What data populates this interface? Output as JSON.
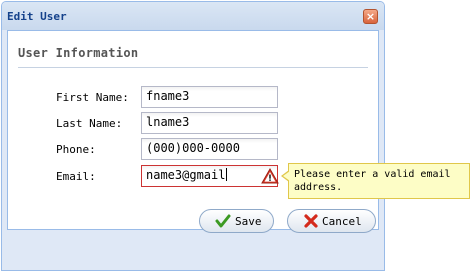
{
  "window": {
    "title": "Edit User",
    "close_label": "×"
  },
  "form": {
    "legend": "User Information",
    "fields": [
      {
        "label": "First Name:",
        "value": "fname3"
      },
      {
        "label": "Last Name:",
        "value": "lname3"
      },
      {
        "label": "Phone:",
        "value": "(000)000-0000"
      },
      {
        "label": "Email:",
        "value": "name3@gmail"
      }
    ]
  },
  "validation": {
    "message": "Please enter a valid email address."
  },
  "buttons": {
    "save": "Save",
    "cancel": "Cancel"
  },
  "icons": {
    "close": "close-icon",
    "warning": "warning-triangle-icon",
    "save": "checkmark-icon",
    "cancel": "red-x-icon"
  },
  "colors": {
    "title_text": "#15428b",
    "error_border": "#cc3333",
    "tooltip_bg": "#fdfdc6"
  }
}
